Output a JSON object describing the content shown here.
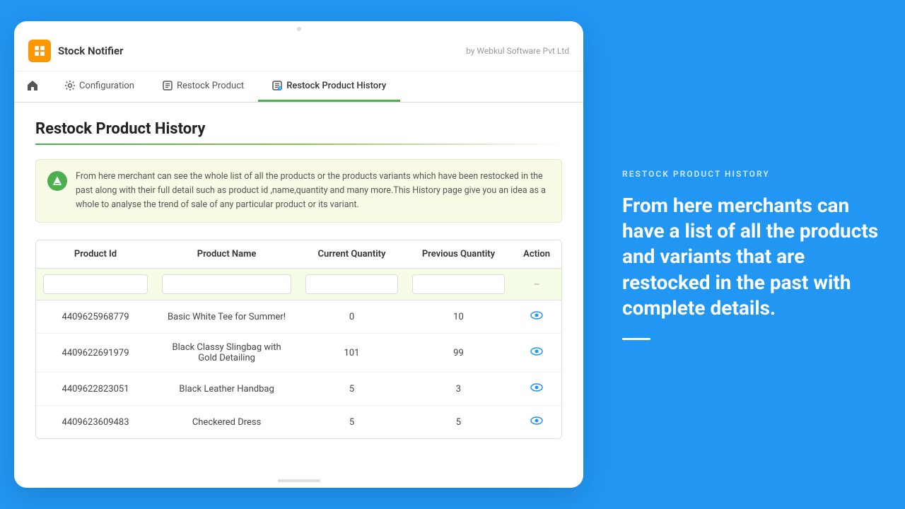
{
  "app": {
    "title": "Stock Notifier",
    "by": "by Webkul Software Pvt Ltd"
  },
  "nav": {
    "home_icon": "🏠",
    "items": [
      {
        "id": "configuration",
        "label": "Configuration",
        "icon": "⚙️",
        "active": false
      },
      {
        "id": "restock-product",
        "label": "Restock Product",
        "icon": "📋",
        "active": false
      },
      {
        "id": "restock-product-history",
        "label": "Restock Product History",
        "icon": "📄",
        "active": true
      }
    ]
  },
  "page": {
    "title": "Restock Product History",
    "info_text": "From here merchant can see the whole list of all the products or the products variants which have been restocked in the past along with their full detail such as product id ,name,quantity and many more.This History page give you an idea as a whole to analyse the trend of sale of any particular product or its variant."
  },
  "table": {
    "columns": [
      "Product Id",
      "Product Name",
      "Current Quantity",
      "Previous Quantity",
      "Action"
    ],
    "filter_placeholder": "--",
    "rows": [
      {
        "product_id": "4409625968779",
        "product_name": "Basic White Tee for Summer!",
        "current_qty": "0",
        "previous_qty": "10",
        "action": "view"
      },
      {
        "product_id": "4409622691979",
        "product_name": "Black Classy Slingbag with Gold Detailing",
        "current_qty": "101",
        "previous_qty": "99",
        "action": "view"
      },
      {
        "product_id": "4409622823051",
        "product_name": "Black Leather Handbag",
        "current_qty": "5",
        "previous_qty": "3",
        "action": "view"
      },
      {
        "product_id": "4409623609483",
        "product_name": "Checkered Dress",
        "current_qty": "5",
        "previous_qty": "5",
        "action": "view"
      }
    ]
  },
  "right_panel": {
    "label": "RESTOCK PRODUCT HISTORY",
    "description": "From here merchants can have a list of all the products and variants that are restocked in the past with complete details."
  }
}
